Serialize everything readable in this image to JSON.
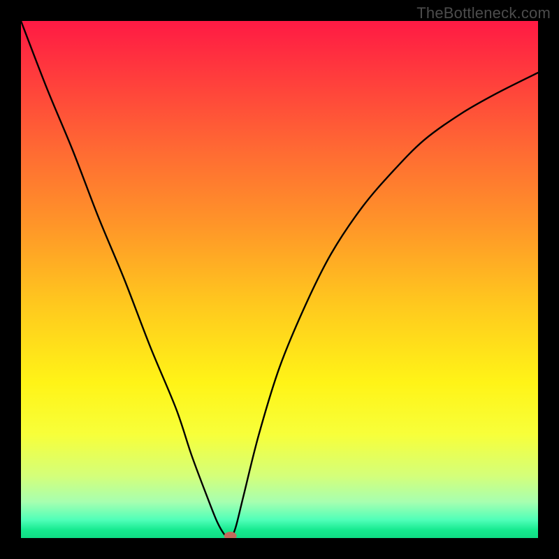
{
  "watermark": "TheBottleneck.com",
  "chart_data": {
    "type": "line",
    "title": "",
    "xlabel": "",
    "ylabel": "",
    "xlim": [
      0,
      100
    ],
    "ylim": [
      0,
      100
    ],
    "grid": false,
    "legend": false,
    "background_gradient": {
      "stops": [
        {
          "offset": 0.0,
          "color": "#ff1a44"
        },
        {
          "offset": 0.1,
          "color": "#ff3a3d"
        },
        {
          "offset": 0.25,
          "color": "#ff6a33"
        },
        {
          "offset": 0.4,
          "color": "#ff9728"
        },
        {
          "offset": 0.55,
          "color": "#ffc91e"
        },
        {
          "offset": 0.7,
          "color": "#fff417"
        },
        {
          "offset": 0.8,
          "color": "#f7ff3a"
        },
        {
          "offset": 0.88,
          "color": "#d4ff7a"
        },
        {
          "offset": 0.93,
          "color": "#a7ffb0"
        },
        {
          "offset": 0.965,
          "color": "#4fffb8"
        },
        {
          "offset": 0.985,
          "color": "#15e98e"
        },
        {
          "offset": 1.0,
          "color": "#0fdc84"
        }
      ]
    },
    "series": [
      {
        "name": "bottleneck-curve",
        "color": "#000000",
        "x": [
          0,
          5,
          10,
          15,
          20,
          25,
          30,
          33,
          36,
          38,
          39.5,
          40.5,
          41.5,
          43,
          46,
          50,
          55,
          60,
          66,
          72,
          78,
          85,
          92,
          100
        ],
        "values": [
          100,
          87,
          75,
          62,
          50,
          37,
          25,
          16,
          8,
          3,
          0.5,
          0,
          2,
          8,
          20,
          33,
          45,
          55,
          64,
          71,
          77,
          82,
          86,
          90
        ]
      }
    ],
    "marker": {
      "name": "optimum-marker",
      "x": 40.5,
      "y": 0,
      "color": "#c26a5c",
      "rx": 9,
      "ry": 6
    }
  }
}
